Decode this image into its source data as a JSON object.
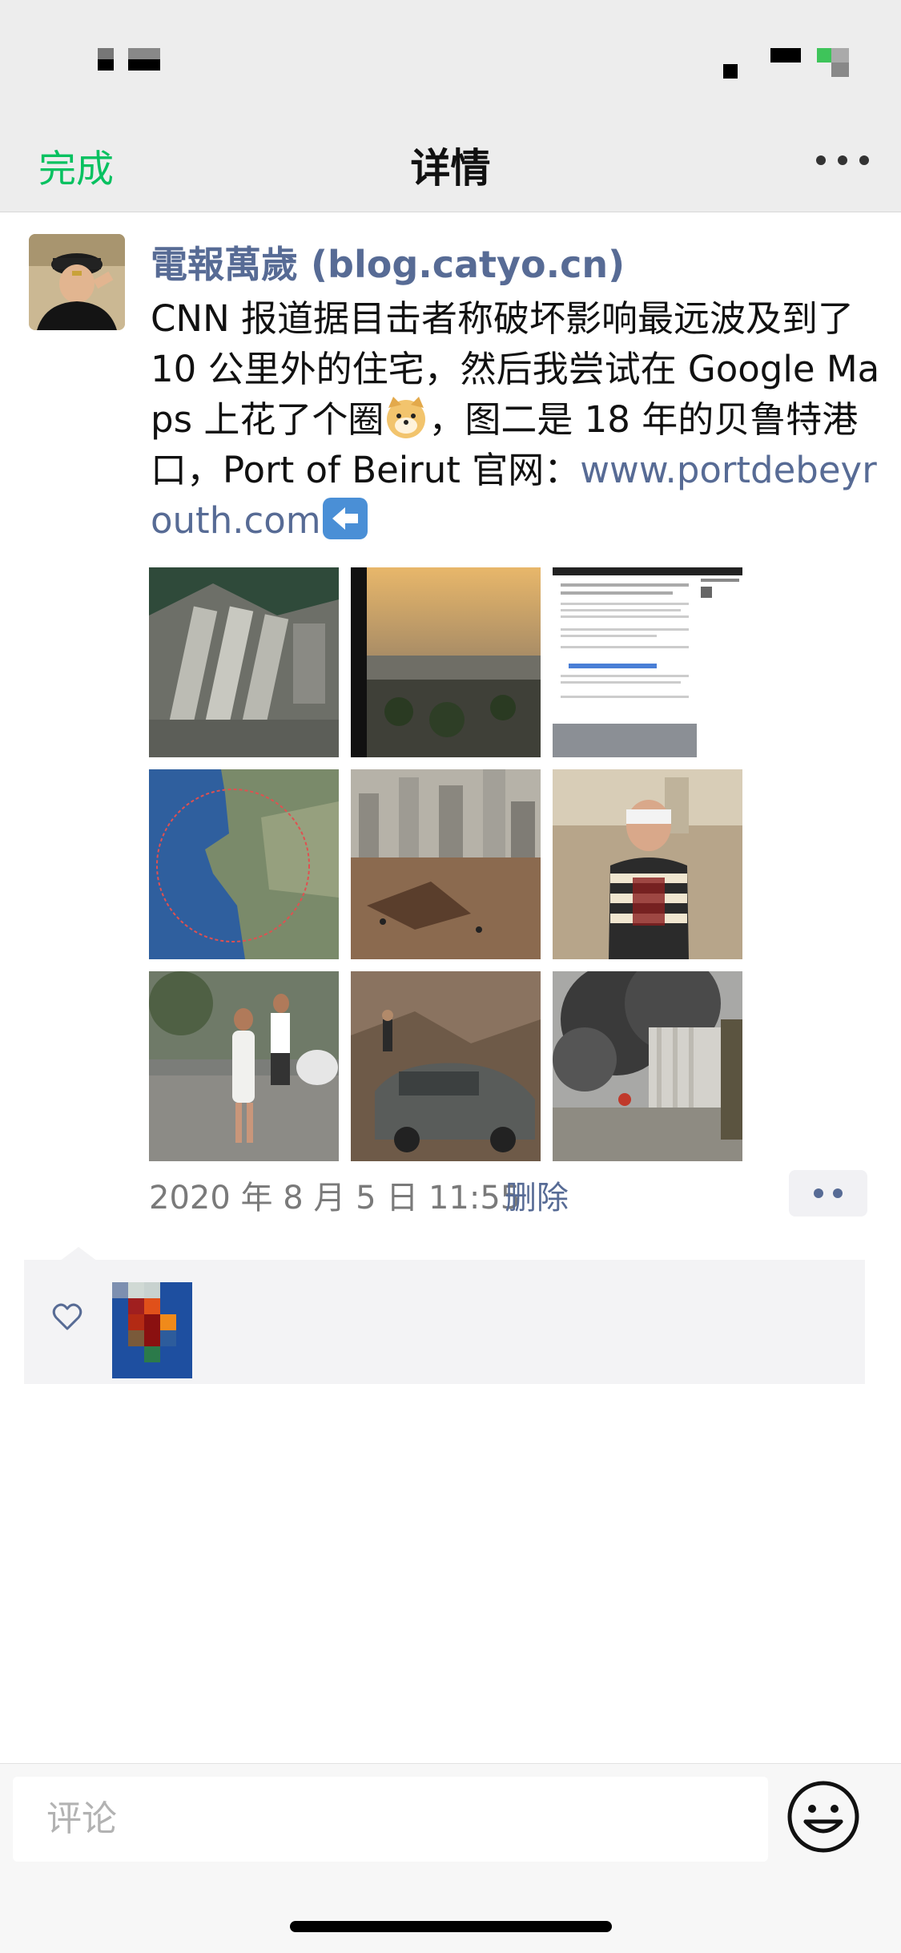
{
  "nav": {
    "done": "完成",
    "title": "详情"
  },
  "post": {
    "author": "電報萬歲 (blog.catyo.cn)",
    "text_part1": "CNN 报道据目击者称破坏影响最远波及到了 10 公里外的住宅，然后我尝试在 Google Maps 上花了个圈",
    "text_part2": "，图二是 18 年的贝鲁特港口，Port of Beirut 官网：",
    "link": "www.portdebeyrouth.com",
    "timestamp": "2020 年 8 月 5 日 11:55",
    "delete_label": "删除",
    "images": [
      "satellite-port-image",
      "port-sunset-image",
      "website-screenshot-image",
      "map-circle-image",
      "explosion-aftermath-image",
      "injured-man-image",
      "woman-running-image",
      "damaged-car-image",
      "smoke-silo-image"
    ]
  },
  "comment": {
    "placeholder": "评论"
  },
  "colors": {
    "accent": "#07c160",
    "link": "#576b95"
  }
}
